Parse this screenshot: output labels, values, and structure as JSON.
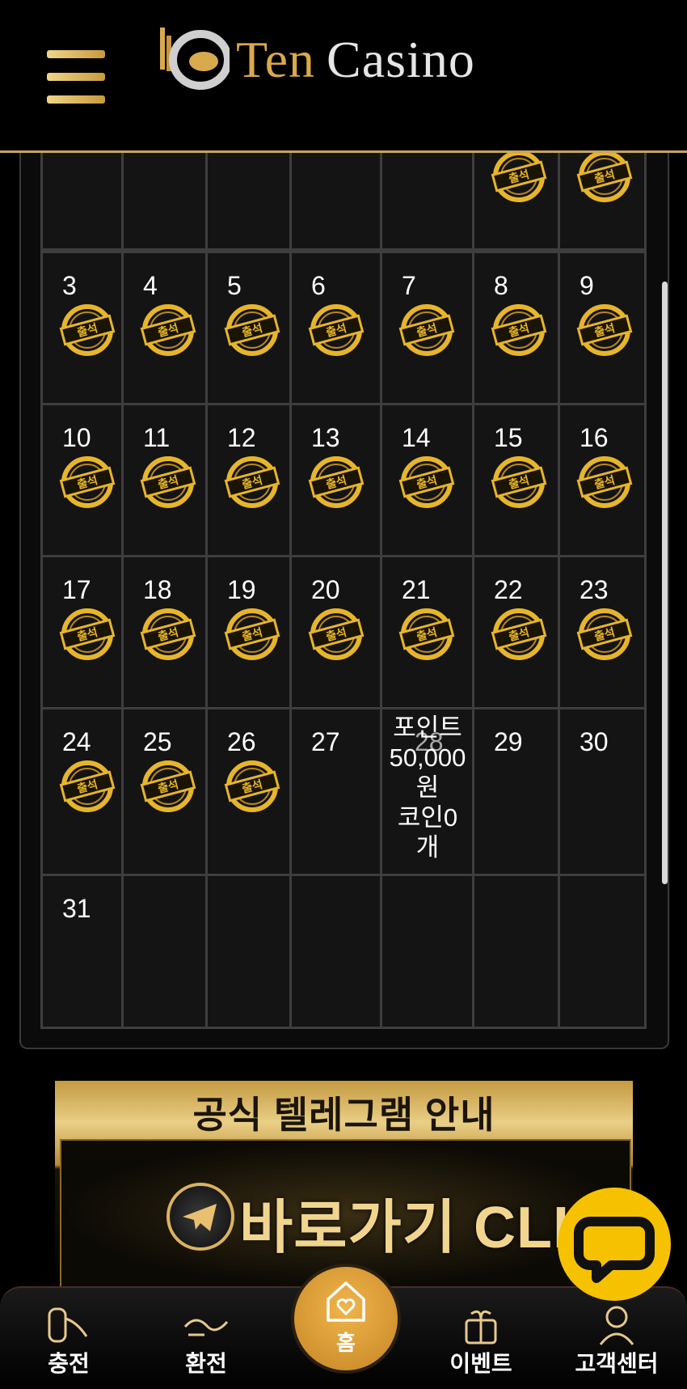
{
  "header": {
    "menu_icon": "hamburger-icon",
    "logo_ten": "Ten",
    "logo_casino": "Casino"
  },
  "calendar": {
    "stamp_label": "출석",
    "rows": [
      [
        {
          "day": "",
          "checked": false
        },
        {
          "day": "",
          "checked": false
        },
        {
          "day": "",
          "checked": false
        },
        {
          "day": "",
          "checked": false
        },
        {
          "day": "",
          "checked": false
        },
        {
          "day": "",
          "checked": true
        },
        {
          "day": "",
          "checked": true
        }
      ],
      [
        {
          "day": "3",
          "checked": true
        },
        {
          "day": "4",
          "checked": true
        },
        {
          "day": "5",
          "checked": true
        },
        {
          "day": "6",
          "checked": true
        },
        {
          "day": "7",
          "checked": true
        },
        {
          "day": "8",
          "checked": true
        },
        {
          "day": "9",
          "checked": true
        }
      ],
      [
        {
          "day": "10",
          "checked": true
        },
        {
          "day": "11",
          "checked": true
        },
        {
          "day": "12",
          "checked": true
        },
        {
          "day": "13",
          "checked": true
        },
        {
          "day": "14",
          "checked": true
        },
        {
          "day": "15",
          "checked": true
        },
        {
          "day": "16",
          "checked": true
        }
      ],
      [
        {
          "day": "17",
          "checked": true
        },
        {
          "day": "18",
          "checked": true
        },
        {
          "day": "19",
          "checked": true
        },
        {
          "day": "20",
          "checked": true
        },
        {
          "day": "21",
          "checked": true
        },
        {
          "day": "22",
          "checked": true
        },
        {
          "day": "23",
          "checked": true
        }
      ],
      [
        {
          "day": "24",
          "checked": true
        },
        {
          "day": "25",
          "checked": true
        },
        {
          "day": "26",
          "checked": true
        },
        {
          "day": "27",
          "checked": false
        },
        {
          "day": "28",
          "checked": false
        },
        {
          "day": "29",
          "checked": false
        },
        {
          "day": "30",
          "checked": false
        }
      ],
      [
        {
          "day": "31",
          "checked": false
        },
        {
          "day": "",
          "checked": false
        },
        {
          "day": "",
          "checked": false
        },
        {
          "day": "",
          "checked": false
        },
        {
          "day": "",
          "checked": false
        },
        {
          "day": "",
          "checked": false
        },
        {
          "day": "",
          "checked": false
        }
      ]
    ],
    "today_info": {
      "day": "28",
      "lines": [
        "포인트",
        "50,000",
        "원",
        "코인0",
        "개"
      ]
    }
  },
  "banner": {
    "title": "공식 텔레그램 안내",
    "cta": "바로가기 CLICK",
    "icon": "telegram-icon"
  },
  "chat": {
    "icon": "chat-bubble-icon"
  },
  "bottom_nav": {
    "items": [
      {
        "label": "충전",
        "icon": "deposit-icon"
      },
      {
        "label": "환전",
        "icon": "withdraw-icon"
      },
      {
        "label": "홈",
        "icon": "home-heart-icon"
      },
      {
        "label": "이벤트",
        "icon": "gift-icon"
      },
      {
        "label": "고객센터",
        "icon": "support-icon"
      }
    ]
  },
  "colors": {
    "gold": "#d9a94d",
    "chat_yellow": "#f6c200",
    "home_orange": "#e0a23c"
  }
}
